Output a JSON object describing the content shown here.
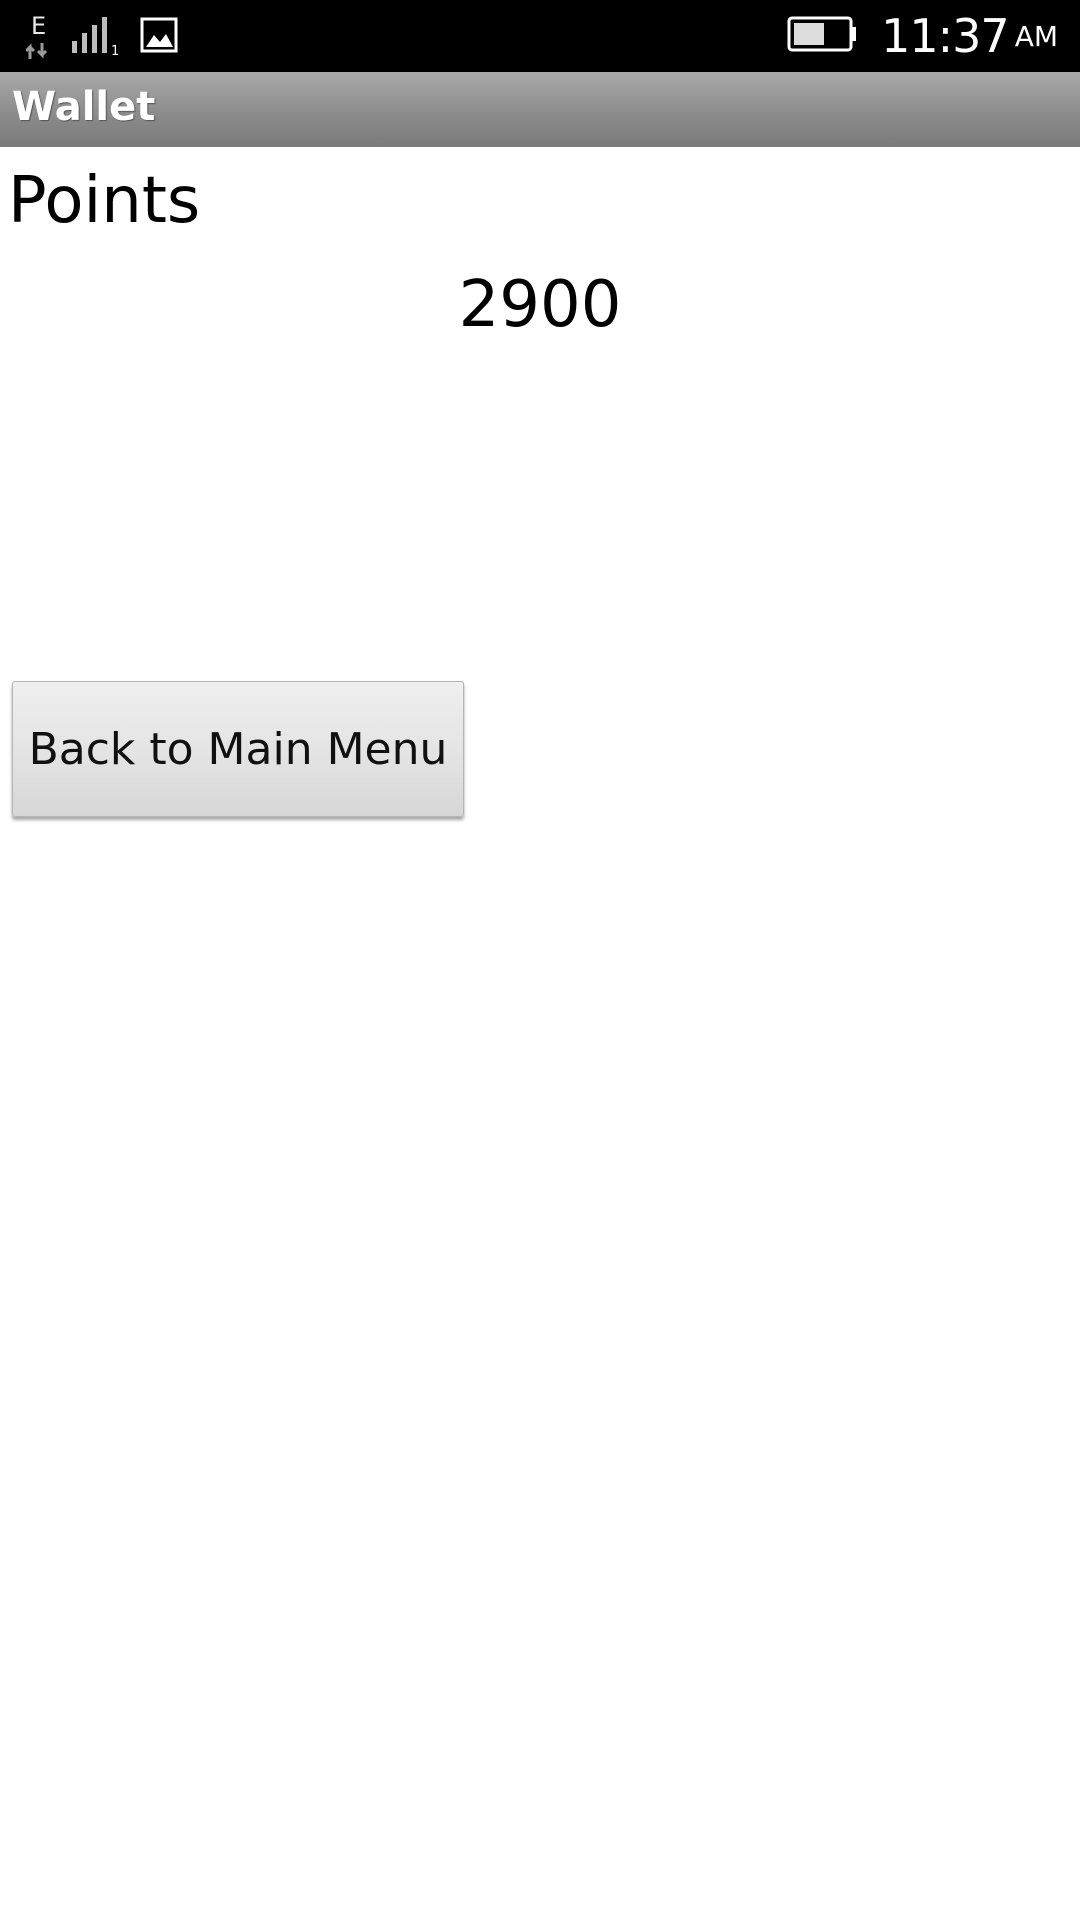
{
  "status_bar": {
    "network_type": "E",
    "sim_slot": "1",
    "time": "11:37",
    "ampm": "AM",
    "icons": [
      "data-arrows-icon",
      "signal-bars-icon",
      "gallery-notification-icon",
      "battery-icon"
    ],
    "battery_level": 0.5
  },
  "app_bar": {
    "title": "Wallet"
  },
  "main": {
    "points_label": "Points",
    "points_value": "2900",
    "back_button_label": "Back to Main Menu"
  },
  "colors": {
    "status_bar_bg": "#000000",
    "title_bar_bg": "#8c8c8c",
    "page_bg": "#ffffff",
    "button_bg": "#e2e2e2"
  }
}
